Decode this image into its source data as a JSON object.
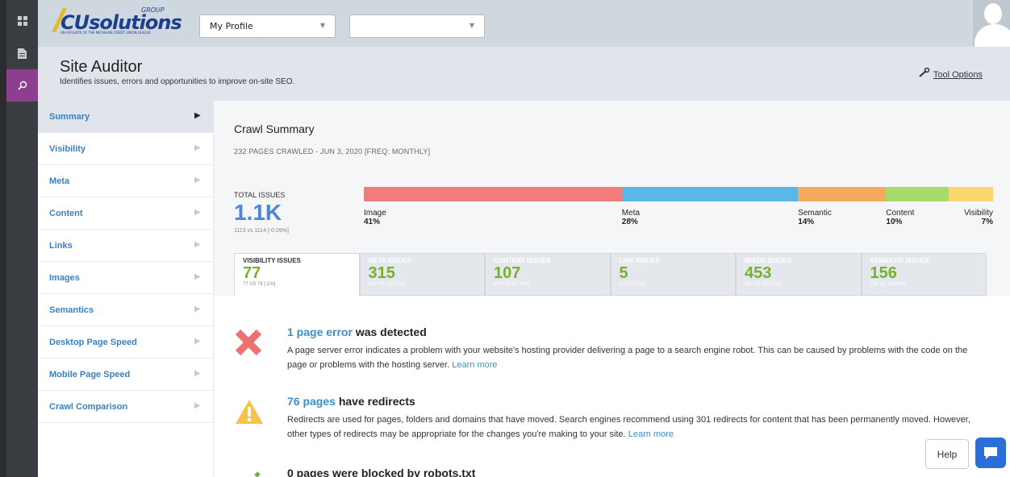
{
  "logo": {
    "main": "CUsolutions",
    "group": "GROUP",
    "sub": "AN AFFILIATE OF THE MICHIGAN CREDIT UNION LEAGUE"
  },
  "topbar": {
    "profile_select": "My Profile",
    "second_select": ""
  },
  "header": {
    "title": "Site Auditor",
    "subtitle": "Identifies issues, errors and opportunities to improve on-site SEO.",
    "tool_options": "Tool Options"
  },
  "sidenav": {
    "items": [
      {
        "label": "Summary"
      },
      {
        "label": "Visibility"
      },
      {
        "label": "Meta"
      },
      {
        "label": "Content"
      },
      {
        "label": "Links"
      },
      {
        "label": "Images"
      },
      {
        "label": "Semantics"
      },
      {
        "label": "Desktop Page Speed"
      },
      {
        "label": "Mobile Page Speed"
      },
      {
        "label": "Crawl Comparison"
      }
    ]
  },
  "crawl": {
    "title": "Crawl Summary",
    "meta": "232 PAGES CRAWLED - JUN 3, 2020 [FREQ: MONTHLY]",
    "total_label": "TOTAL ISSUES",
    "total_value": "1.1K",
    "total_compare": "1113 vs 1114 [-0.09%]"
  },
  "breakdown": [
    {
      "name": "Image",
      "pct": "41%",
      "share": 41,
      "color": "#f27b7b"
    },
    {
      "name": "Meta",
      "pct": "28%",
      "share": 28,
      "color": "#5bb8e4"
    },
    {
      "name": "Semantic",
      "pct": "14%",
      "share": 14,
      "color": "#f7a95c"
    },
    {
      "name": "Content",
      "pct": "10%",
      "share": 10,
      "color": "#a6da6a"
    },
    {
      "name": "Visibility",
      "pct": "7%",
      "share": 7,
      "color": "#fbd66e"
    }
  ],
  "issue_tabs": [
    {
      "title": "VISIBILITY ISSUES",
      "value": "77",
      "compare": "77 VS 78 [-1%]"
    },
    {
      "title": "META ISSUES",
      "value": "315",
      "compare": "315 VS 315 [0%]"
    },
    {
      "title": "CONTENT ISSUES",
      "value": "107",
      "compare": "107 VS 107 [0%]"
    },
    {
      "title": "LINK ISSUES",
      "value": "5",
      "compare": "5 VS 5 [0%]"
    },
    {
      "title": "IMAGE ISSUES",
      "value": "453",
      "compare": "453 VS 453 [0%]"
    },
    {
      "title": "SEMANTIC ISSUES",
      "value": "156",
      "compare": "156 VS 156 [0%]"
    }
  ],
  "alerts": [
    {
      "icon": "error-x-icon",
      "link": "1 page error",
      "rest": " was detected",
      "body": "A page server error indicates a problem with your website's hosting provider delivering a page to a search engine robot. This can be caused by problems with the code on the page or problems with the hosting server. ",
      "learn": "Learn more"
    },
    {
      "icon": "warning-icon",
      "link": "76 pages",
      "rest": " have redirects",
      "body": "Redirects are used for pages, folders and domains that have moved. Search engines recommend using 301 redirects for content that has been permanently moved. However, other types of redirects may be appropriate for the changes you're making to your site. ",
      "learn": "Learn more"
    },
    {
      "icon": "checkmark-icon",
      "link": "",
      "rest": "0 pages were blocked by robots.txt",
      "body": "",
      "learn": ""
    }
  ],
  "help": {
    "label": "Help"
  }
}
